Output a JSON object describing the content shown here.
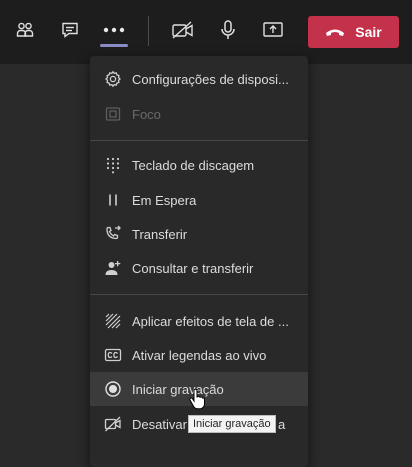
{
  "toolbar": {
    "buttons": [
      {
        "icon": "people-icon"
      },
      {
        "icon": "chat-icon"
      },
      {
        "icon": "more-options-icon"
      },
      {
        "icon": "camera-off-icon"
      },
      {
        "icon": "microphone-icon"
      },
      {
        "icon": "share-screen-icon"
      }
    ],
    "leave_label": "Sair",
    "leave_color": "#c4314b",
    "accent_color": "#8b8cc7"
  },
  "menu": {
    "items": [
      {
        "label": "Configurações de disposi...",
        "icon": "gear-icon"
      },
      {
        "label": "Foco",
        "icon": "focus-icon",
        "disabled": true
      },
      {
        "label": "Teclado de discagem",
        "icon": "dialpad-icon"
      },
      {
        "label": "Em Espera",
        "icon": "hold-icon"
      },
      {
        "label": "Transferir",
        "icon": "transfer-icon"
      },
      {
        "label": "Consultar e transferir",
        "icon": "consult-transfer-icon"
      },
      {
        "label": "Aplicar efeitos de tela de ...",
        "icon": "background-effects-icon"
      },
      {
        "label": "Ativar legendas ao vivo",
        "icon": "captions-icon"
      },
      {
        "label": "Iniciar gravação",
        "icon": "record-icon"
      },
      {
        "label": "Desativar",
        "label_tail": "a",
        "icon": "video-off-icon"
      }
    ]
  },
  "tooltip": "Iniciar gravação"
}
